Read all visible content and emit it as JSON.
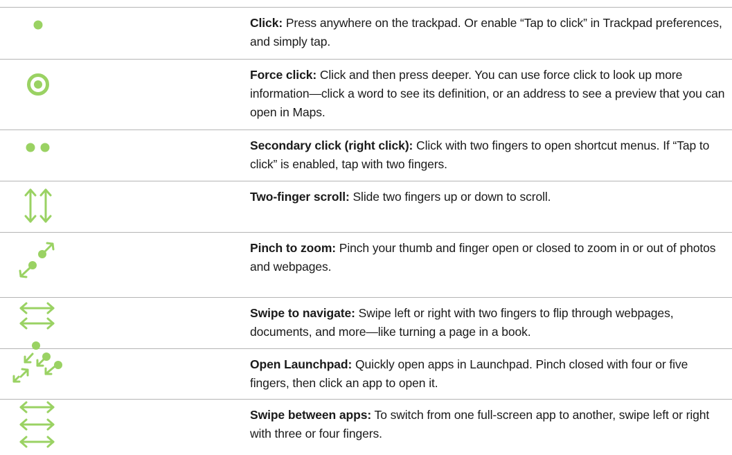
{
  "gestures": [
    {
      "icon": "single-dot-icon",
      "term": "Click:",
      "desc": " Press anywhere on the trackpad. Or enable “Tap to click” in Trackpad preferences, and simply tap."
    },
    {
      "icon": "target-circle-icon",
      "term": "Force click:",
      "desc": " Click and then press deeper. You can use force click to look up more information—click a word to see its definition, or an address to see a preview that you can open in Maps."
    },
    {
      "icon": "two-dots-icon",
      "term": "Secondary click (right click):",
      "desc": " Click with two fingers to open shortcut menus. If “Tap to click” is enabled, tap with two fingers."
    },
    {
      "icon": "vertical-double-arrow-icon",
      "term": "Two-finger scroll:",
      "desc": " Slide two fingers up or down to scroll."
    },
    {
      "icon": "pinch-zoom-icon",
      "term": "Pinch to zoom:",
      "desc": " Pinch your thumb and finger open or closed to zoom in or out of photos and webpages."
    },
    {
      "icon": "two-horizontal-arrows-icon",
      "term": "Swipe to navigate:",
      "desc": " Swipe left or right with two fingers to flip through webpages, documents, and more—like turning a page in a book."
    },
    {
      "icon": "launchpad-pinch-icon",
      "term": "Open Launchpad:",
      "desc": " Quickly open apps in Launchpad. Pinch closed with four or five fingers, then click an app to open it."
    },
    {
      "icon": "three-horizontal-arrows-icon",
      "term": "Swipe between apps:",
      "desc": " To switch from one full-screen app to another, swipe left or right with three or four fingers."
    }
  ],
  "colors": {
    "accent": "#9ad263",
    "divider": "#b4b4b4",
    "text": "#1a1a1a"
  }
}
